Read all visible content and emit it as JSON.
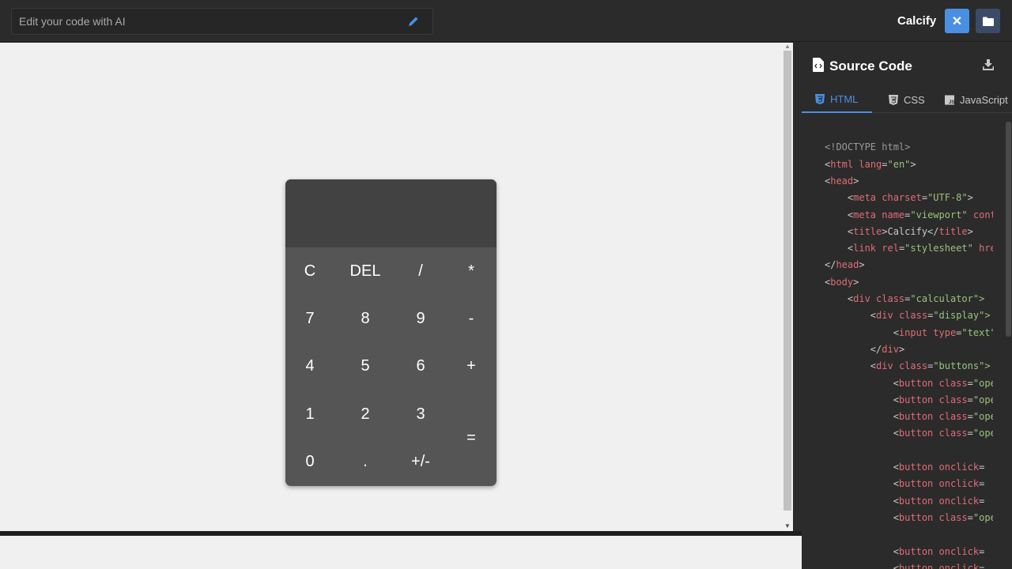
{
  "topbar": {
    "ai_placeholder": "Edit your code with AI",
    "brand": "Calcify",
    "close_label": "✕",
    "accent_color": "#4a90e2"
  },
  "calculator": {
    "display_value": "",
    "buttons": [
      {
        "label": "C",
        "name": "calc-clear-button"
      },
      {
        "label": "DEL",
        "name": "calc-delete-button"
      },
      {
        "label": "/",
        "name": "calc-divide-button"
      },
      {
        "label": "*",
        "name": "calc-multiply-button"
      },
      {
        "label": "7",
        "name": "calc-7-button"
      },
      {
        "label": "8",
        "name": "calc-8-button"
      },
      {
        "label": "9",
        "name": "calc-9-button"
      },
      {
        "label": "-",
        "name": "calc-minus-button"
      },
      {
        "label": "4",
        "name": "calc-4-button"
      },
      {
        "label": "5",
        "name": "calc-5-button"
      },
      {
        "label": "6",
        "name": "calc-6-button"
      },
      {
        "label": "+",
        "name": "calc-plus-button"
      },
      {
        "label": "1",
        "name": "calc-1-button"
      },
      {
        "label": "2",
        "name": "calc-2-button"
      },
      {
        "label": "3",
        "name": "calc-3-button"
      },
      {
        "label": "=",
        "name": "calc-equals-button"
      },
      {
        "label": "0",
        "name": "calc-0-button"
      },
      {
        "label": ".",
        "name": "calc-decimal-button"
      },
      {
        "label": "+/-",
        "name": "calc-sign-button"
      }
    ]
  },
  "source": {
    "title": "Source Code",
    "tabs": [
      {
        "label": "HTML",
        "icon": "html5-icon",
        "active": true
      },
      {
        "label": "CSS",
        "icon": "css3-icon",
        "active": false
      },
      {
        "label": "JavaScript",
        "icon": "js-icon",
        "active": false
      }
    ],
    "code_lines": [
      [],
      [
        {
          "t": "<!DOCTYPE html>",
          "c": "cm"
        }
      ],
      [
        {
          "t": "<",
          "c": "pl"
        },
        {
          "t": "html",
          "c": "tg"
        },
        {
          "t": " lang",
          "c": "at"
        },
        {
          "t": "=",
          "c": "pl"
        },
        {
          "t": "\"en\"",
          "c": "st"
        },
        {
          "t": ">",
          "c": "pl"
        }
      ],
      [
        {
          "t": "<",
          "c": "pl"
        },
        {
          "t": "head",
          "c": "tg"
        },
        {
          "t": ">",
          "c": "pl"
        }
      ],
      [
        {
          "t": "    <",
          "c": "pl"
        },
        {
          "t": "meta",
          "c": "tg"
        },
        {
          "t": " charset",
          "c": "at"
        },
        {
          "t": "=",
          "c": "pl"
        },
        {
          "t": "\"UTF-8\"",
          "c": "st"
        },
        {
          "t": ">",
          "c": "pl"
        }
      ],
      [
        {
          "t": "    <",
          "c": "pl"
        },
        {
          "t": "meta",
          "c": "tg"
        },
        {
          "t": " name",
          "c": "at"
        },
        {
          "t": "=",
          "c": "pl"
        },
        {
          "t": "\"viewport\"",
          "c": "st"
        },
        {
          "t": " content",
          "c": "at"
        }
      ],
      [
        {
          "t": "    <",
          "c": "pl"
        },
        {
          "t": "title",
          "c": "tg"
        },
        {
          "t": ">Calcify</",
          "c": "pl"
        },
        {
          "t": "title",
          "c": "tg"
        },
        {
          "t": ">",
          "c": "pl"
        }
      ],
      [
        {
          "t": "    <",
          "c": "pl"
        },
        {
          "t": "link",
          "c": "tg"
        },
        {
          "t": " rel",
          "c": "at"
        },
        {
          "t": "=",
          "c": "pl"
        },
        {
          "t": "\"stylesheet\"",
          "c": "st"
        },
        {
          "t": " href",
          "c": "at"
        }
      ],
      [
        {
          "t": "</",
          "c": "pl"
        },
        {
          "t": "head",
          "c": "tg"
        },
        {
          "t": ">",
          "c": "pl"
        }
      ],
      [
        {
          "t": "<",
          "c": "pl"
        },
        {
          "t": "body",
          "c": "tg"
        },
        {
          "t": ">",
          "c": "pl"
        }
      ],
      [
        {
          "t": "    <",
          "c": "pl"
        },
        {
          "t": "div",
          "c": "tg"
        },
        {
          "t": " class",
          "c": "at"
        },
        {
          "t": "=",
          "c": "pl"
        },
        {
          "t": "\"calculator\">",
          "c": "st"
        }
      ],
      [
        {
          "t": "        <",
          "c": "pl"
        },
        {
          "t": "div",
          "c": "tg"
        },
        {
          "t": " class",
          "c": "at"
        },
        {
          "t": "=",
          "c": "pl"
        },
        {
          "t": "\"display\">",
          "c": "st"
        }
      ],
      [
        {
          "t": "            <",
          "c": "pl"
        },
        {
          "t": "input",
          "c": "tg"
        },
        {
          "t": " type",
          "c": "at"
        },
        {
          "t": "=",
          "c": "pl"
        },
        {
          "t": "\"text\"",
          "c": "st"
        }
      ],
      [
        {
          "t": "        </",
          "c": "pl"
        },
        {
          "t": "div",
          "c": "tg"
        },
        {
          "t": ">",
          "c": "pl"
        }
      ],
      [
        {
          "t": "        <",
          "c": "pl"
        },
        {
          "t": "div",
          "c": "tg"
        },
        {
          "t": " class",
          "c": "at"
        },
        {
          "t": "=",
          "c": "pl"
        },
        {
          "t": "\"buttons\">",
          "c": "st"
        }
      ],
      [
        {
          "t": "            <",
          "c": "pl"
        },
        {
          "t": "button",
          "c": "tg"
        },
        {
          "t": " class",
          "c": "at"
        },
        {
          "t": "=",
          "c": "pl"
        },
        {
          "t": "\"operator\"",
          "c": "st"
        }
      ],
      [
        {
          "t": "            <",
          "c": "pl"
        },
        {
          "t": "button",
          "c": "tg"
        },
        {
          "t": " class",
          "c": "at"
        },
        {
          "t": "=",
          "c": "pl"
        },
        {
          "t": "\"operator\"",
          "c": "st"
        }
      ],
      [
        {
          "t": "            <",
          "c": "pl"
        },
        {
          "t": "button",
          "c": "tg"
        },
        {
          "t": " class",
          "c": "at"
        },
        {
          "t": "=",
          "c": "pl"
        },
        {
          "t": "\"operator\"",
          "c": "st"
        }
      ],
      [
        {
          "t": "            <",
          "c": "pl"
        },
        {
          "t": "button",
          "c": "tg"
        },
        {
          "t": " class",
          "c": "at"
        },
        {
          "t": "=",
          "c": "pl"
        },
        {
          "t": "\"operator\"",
          "c": "st"
        }
      ],
      [],
      [
        {
          "t": "            <",
          "c": "pl"
        },
        {
          "t": "button",
          "c": "tg"
        },
        {
          "t": " onclick",
          "c": "at"
        },
        {
          "t": "=",
          "c": "pl"
        }
      ],
      [
        {
          "t": "            <",
          "c": "pl"
        },
        {
          "t": "button",
          "c": "tg"
        },
        {
          "t": " onclick",
          "c": "at"
        },
        {
          "t": "=",
          "c": "pl"
        }
      ],
      [
        {
          "t": "            <",
          "c": "pl"
        },
        {
          "t": "button",
          "c": "tg"
        },
        {
          "t": " onclick",
          "c": "at"
        },
        {
          "t": "=",
          "c": "pl"
        }
      ],
      [
        {
          "t": "            <",
          "c": "pl"
        },
        {
          "t": "button",
          "c": "tg"
        },
        {
          "t": " class",
          "c": "at"
        },
        {
          "t": "=",
          "c": "pl"
        },
        {
          "t": "\"operator\"",
          "c": "st"
        }
      ],
      [],
      [
        {
          "t": "            <",
          "c": "pl"
        },
        {
          "t": "button",
          "c": "tg"
        },
        {
          "t": " onclick",
          "c": "at"
        },
        {
          "t": "=",
          "c": "pl"
        }
      ],
      [
        {
          "t": "            <",
          "c": "pl"
        },
        {
          "t": "button",
          "c": "tg"
        },
        {
          "t": " onclick",
          "c": "at"
        },
        {
          "t": "=",
          "c": "pl"
        }
      ]
    ]
  }
}
